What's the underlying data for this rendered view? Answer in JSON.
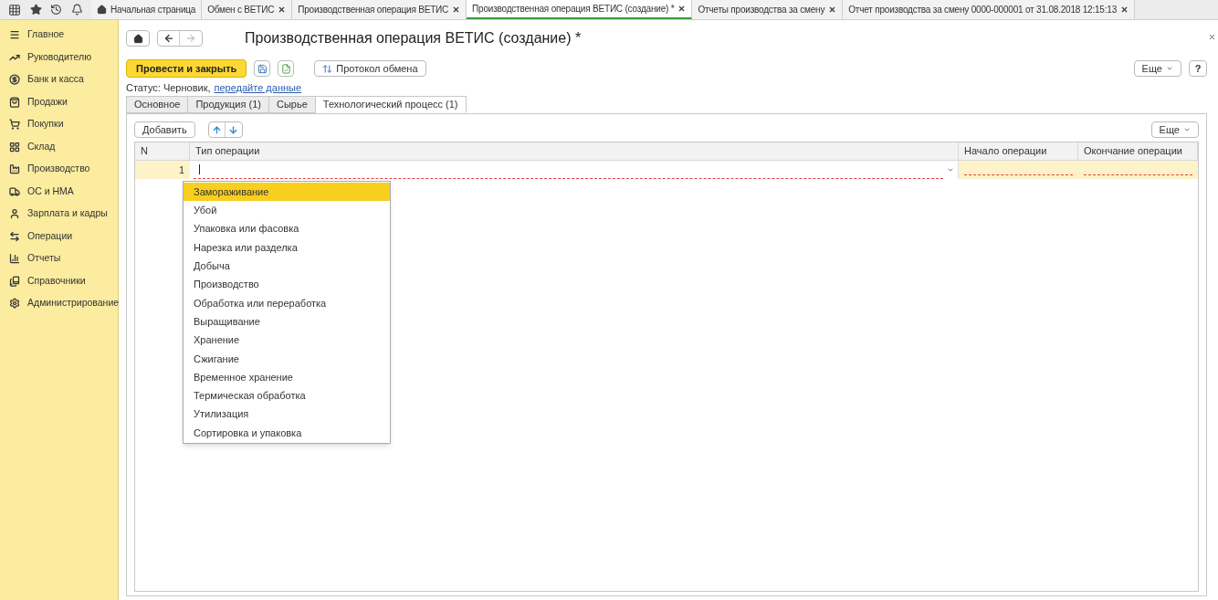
{
  "top_tabs": [
    {
      "label": "Начальная страница",
      "selected": false,
      "kind": "home",
      "closable": false
    },
    {
      "label": "Обмен с ВЕТИС",
      "selected": false,
      "kind": "doc",
      "closable": true
    },
    {
      "label": "Производственная операция ВЕТИС",
      "selected": false,
      "kind": "doc",
      "closable": true
    },
    {
      "label": "Производственная операция ВЕТИС (создание) *",
      "selected": true,
      "kind": "doc",
      "closable": true
    },
    {
      "label": "Отчеты производства за смену",
      "selected": false,
      "kind": "doc",
      "closable": true
    },
    {
      "label": "Отчет производства за смену 0000-000001 от 31.08.2018 12:15:13",
      "selected": false,
      "kind": "doc",
      "closable": true
    }
  ],
  "sidebar": {
    "items": [
      {
        "label": "Главное"
      },
      {
        "label": "Руководителю"
      },
      {
        "label": "Банк и касса"
      },
      {
        "label": "Продажи"
      },
      {
        "label": "Покупки"
      },
      {
        "label": "Склад"
      },
      {
        "label": "Производство"
      },
      {
        "label": "ОС и НМА"
      },
      {
        "label": "Зарплата и кадры"
      },
      {
        "label": "Операции"
      },
      {
        "label": "Отчеты"
      },
      {
        "label": "Справочники"
      },
      {
        "label": "Администрирование"
      }
    ]
  },
  "form": {
    "title": "Производственная операция ВЕТИС (создание) *",
    "post_button": "Провести и закрыть",
    "exchange_button": "Протокол обмена",
    "more_button": "Еще",
    "help_button": "?",
    "status_label": "Статус: Черновик,",
    "status_link": "передайте данные",
    "tabs": [
      {
        "label": "Основное",
        "selected": false
      },
      {
        "label": "Продукция (1)",
        "selected": false
      },
      {
        "label": "Сырье",
        "selected": false
      },
      {
        "label": "Технологический процесс (1)",
        "selected": true
      }
    ],
    "add_button": "Добавить",
    "table_more_button": "Еще",
    "table": {
      "columns": [
        "N",
        "Тип операции",
        "Начало операции",
        "Окончание операции"
      ],
      "rows": [
        {
          "n": "1",
          "selected": true
        }
      ]
    },
    "dropdown": [
      {
        "label": "Замораживание",
        "selected": true
      },
      {
        "label": "Убой",
        "selected": false
      },
      {
        "label": "Упаковка или фасовка",
        "selected": false
      },
      {
        "label": "Нарезка или разделка",
        "selected": false
      },
      {
        "label": "Добыча",
        "selected": false
      },
      {
        "label": "Производство",
        "selected": false
      },
      {
        "label": "Обработка или переработка",
        "selected": false
      },
      {
        "label": "Выращивание",
        "selected": false
      },
      {
        "label": "Хранение",
        "selected": false
      },
      {
        "label": "Сжигание",
        "selected": false
      },
      {
        "label": "Временное хранение",
        "selected": false
      },
      {
        "label": "Термическая обработка",
        "selected": false
      },
      {
        "label": "Утилизация",
        "selected": false
      },
      {
        "label": "Сортировка и упаковка",
        "selected": false
      }
    ]
  }
}
